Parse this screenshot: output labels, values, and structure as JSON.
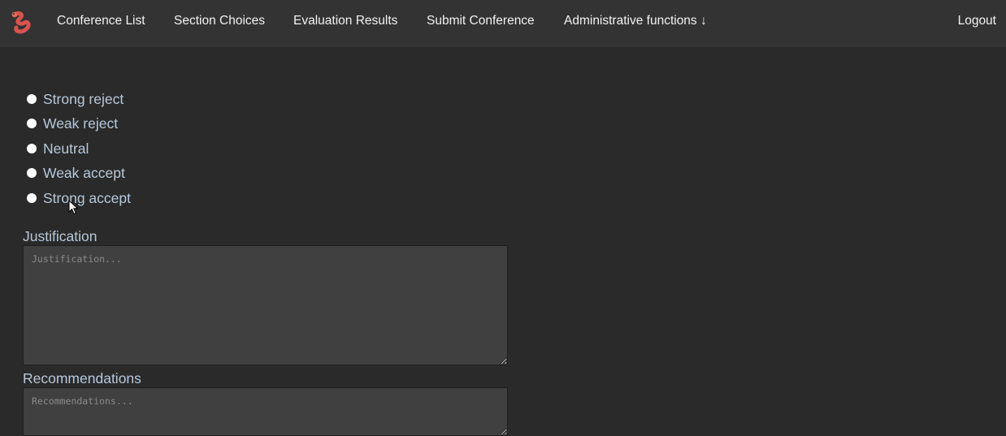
{
  "nav": {
    "items": [
      {
        "label": "Conference List"
      },
      {
        "label": "Section Choices"
      },
      {
        "label": "Evaluation Results"
      },
      {
        "label": "Submit Conference"
      },
      {
        "label": "Administrative functions ↓"
      }
    ],
    "logout": "Logout"
  },
  "evaluation": {
    "options": [
      {
        "label": "Strong reject"
      },
      {
        "label": "Weak reject"
      },
      {
        "label": "Neutral"
      },
      {
        "label": "Weak accept"
      },
      {
        "label": "Strong accept"
      }
    ]
  },
  "justification": {
    "label": "Justification",
    "placeholder": "Justification...",
    "value": ""
  },
  "recommendations": {
    "label": "Recommendations",
    "placeholder": "Recommendations...",
    "value": ""
  },
  "colors": {
    "navbar_bg": "#333333",
    "page_bg": "#2a2a2a",
    "label_text": "#b6c9dc",
    "input_bg": "#404040"
  },
  "icons": {
    "logo": "worm-logo-icon",
    "cursor": "mouse-pointer-icon"
  }
}
